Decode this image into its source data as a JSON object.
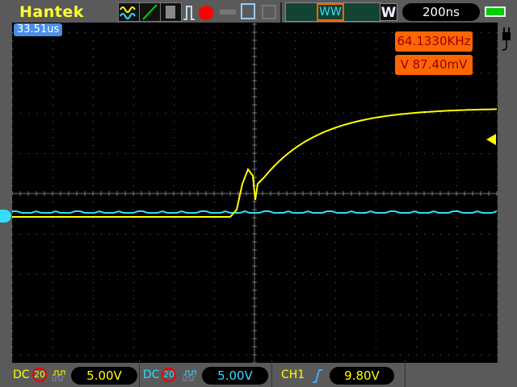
{
  "brand": "Hantek",
  "toolbar": {
    "icons": [
      "dual-wave-icon",
      "line-icon",
      "persistence-icon",
      "pulse-icon",
      "record-icon",
      "key-icon",
      "save-icon",
      "print-icon"
    ],
    "window_button": "W",
    "timebase": "200ns"
  },
  "trigger_position": "33.51us",
  "measurements": {
    "frequency": "64.1330KHz",
    "voltage": "V 87.40mV"
  },
  "ch1": {
    "coupling": "DC",
    "bw_limit": "20",
    "scale": "5.00V",
    "color": "#ffff00"
  },
  "ch2": {
    "coupling": "DC",
    "bw_limit": "20",
    "scale": "5.00V",
    "color": "#33ddee"
  },
  "trigger": {
    "source": "CH1",
    "edge": "rising",
    "level": "9.80V"
  },
  "colors": {
    "ch1": "#ffff00",
    "ch2": "#33ddee",
    "measure_bg": "#ff6600"
  }
}
